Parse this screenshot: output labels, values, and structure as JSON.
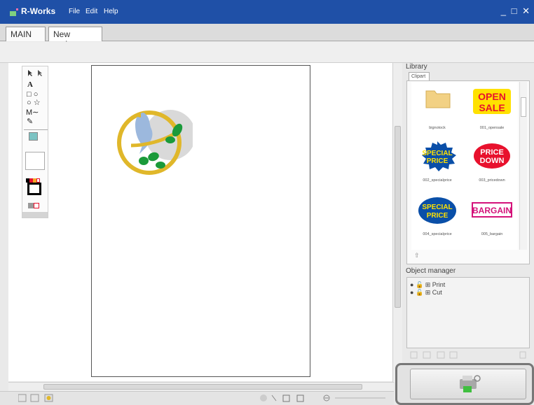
{
  "app": {
    "title": "R-Works",
    "menu": [
      "File",
      "Edit",
      "Help"
    ],
    "window_controls": "_ □ ✕"
  },
  "tabs": [
    {
      "label": "MAIN"
    },
    {
      "label": "New proje",
      "close": "✕"
    }
  ],
  "library": {
    "label": "Library",
    "tab": "Clipart",
    "items": [
      {
        "name": "bignotock",
        "icon": "folder-icon"
      },
      {
        "name": "001_opensale",
        "art": "OPEN|SALE"
      },
      {
        "name": "002_specialprice",
        "art": "SPECIAL|PRICE"
      },
      {
        "name": "003_pricedown",
        "art": "PRICE|DOWN"
      },
      {
        "name": "004_specialprice",
        "art": "SPECIAL|PRICE"
      },
      {
        "name": "005_bargain",
        "art": "BARGAIN"
      }
    ]
  },
  "object_manager": {
    "label": "Object manager",
    "items": [
      "Print",
      "Cut"
    ]
  },
  "colors": {
    "titlebar": "#1f50a7",
    "sale_red": "#e8112d",
    "sale_yellow": "#ffe100",
    "special_blue": "#0a4fa8",
    "bargain_magenta": "#d4127a",
    "ring_gold": "#e0b72a",
    "leaf_green": "#1a9a3a",
    "bird_blue": "#9cb8dd"
  }
}
